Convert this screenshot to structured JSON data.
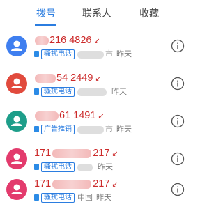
{
  "tabs": [
    {
      "label": "拨号",
      "active": true
    },
    {
      "label": "联系人",
      "active": false
    },
    {
      "label": "收藏",
      "active": false
    }
  ],
  "colors": {
    "accent": "#2b7de0",
    "missed": "#cc2a2a"
  },
  "calls": [
    {
      "number_visible": "216 4826",
      "missed_icon": "missed-call-arrow",
      "tag": "骚扰电话",
      "location_visible": "市",
      "date": "昨天",
      "avatar_color": "#3f7ff0"
    },
    {
      "number_visible": "54 2449",
      "missed_icon": "missed-call-arrow",
      "tag": "骚扰电话",
      "location_visible": "",
      "date": "昨天",
      "avatar_color": "#e14a3d"
    },
    {
      "number_visible": "61 1491",
      "missed_icon": "missed-call-arrow",
      "tag": "广告推销",
      "location_visible": "市",
      "date": "昨天",
      "avatar_color": "#1e9e8a"
    },
    {
      "number_visible": "171 217",
      "missed_icon": "missed-call-arrow",
      "tag": "骚扰电话",
      "location_visible": "",
      "date": "昨天",
      "avatar_color": "#e33b6d"
    },
    {
      "number_visible": "171 217",
      "missed_icon": "missed-call-arrow",
      "tag": "骚扰电话",
      "location_visible": "中国",
      "date": "昨天",
      "avatar_color": "#e33b6d"
    }
  ]
}
